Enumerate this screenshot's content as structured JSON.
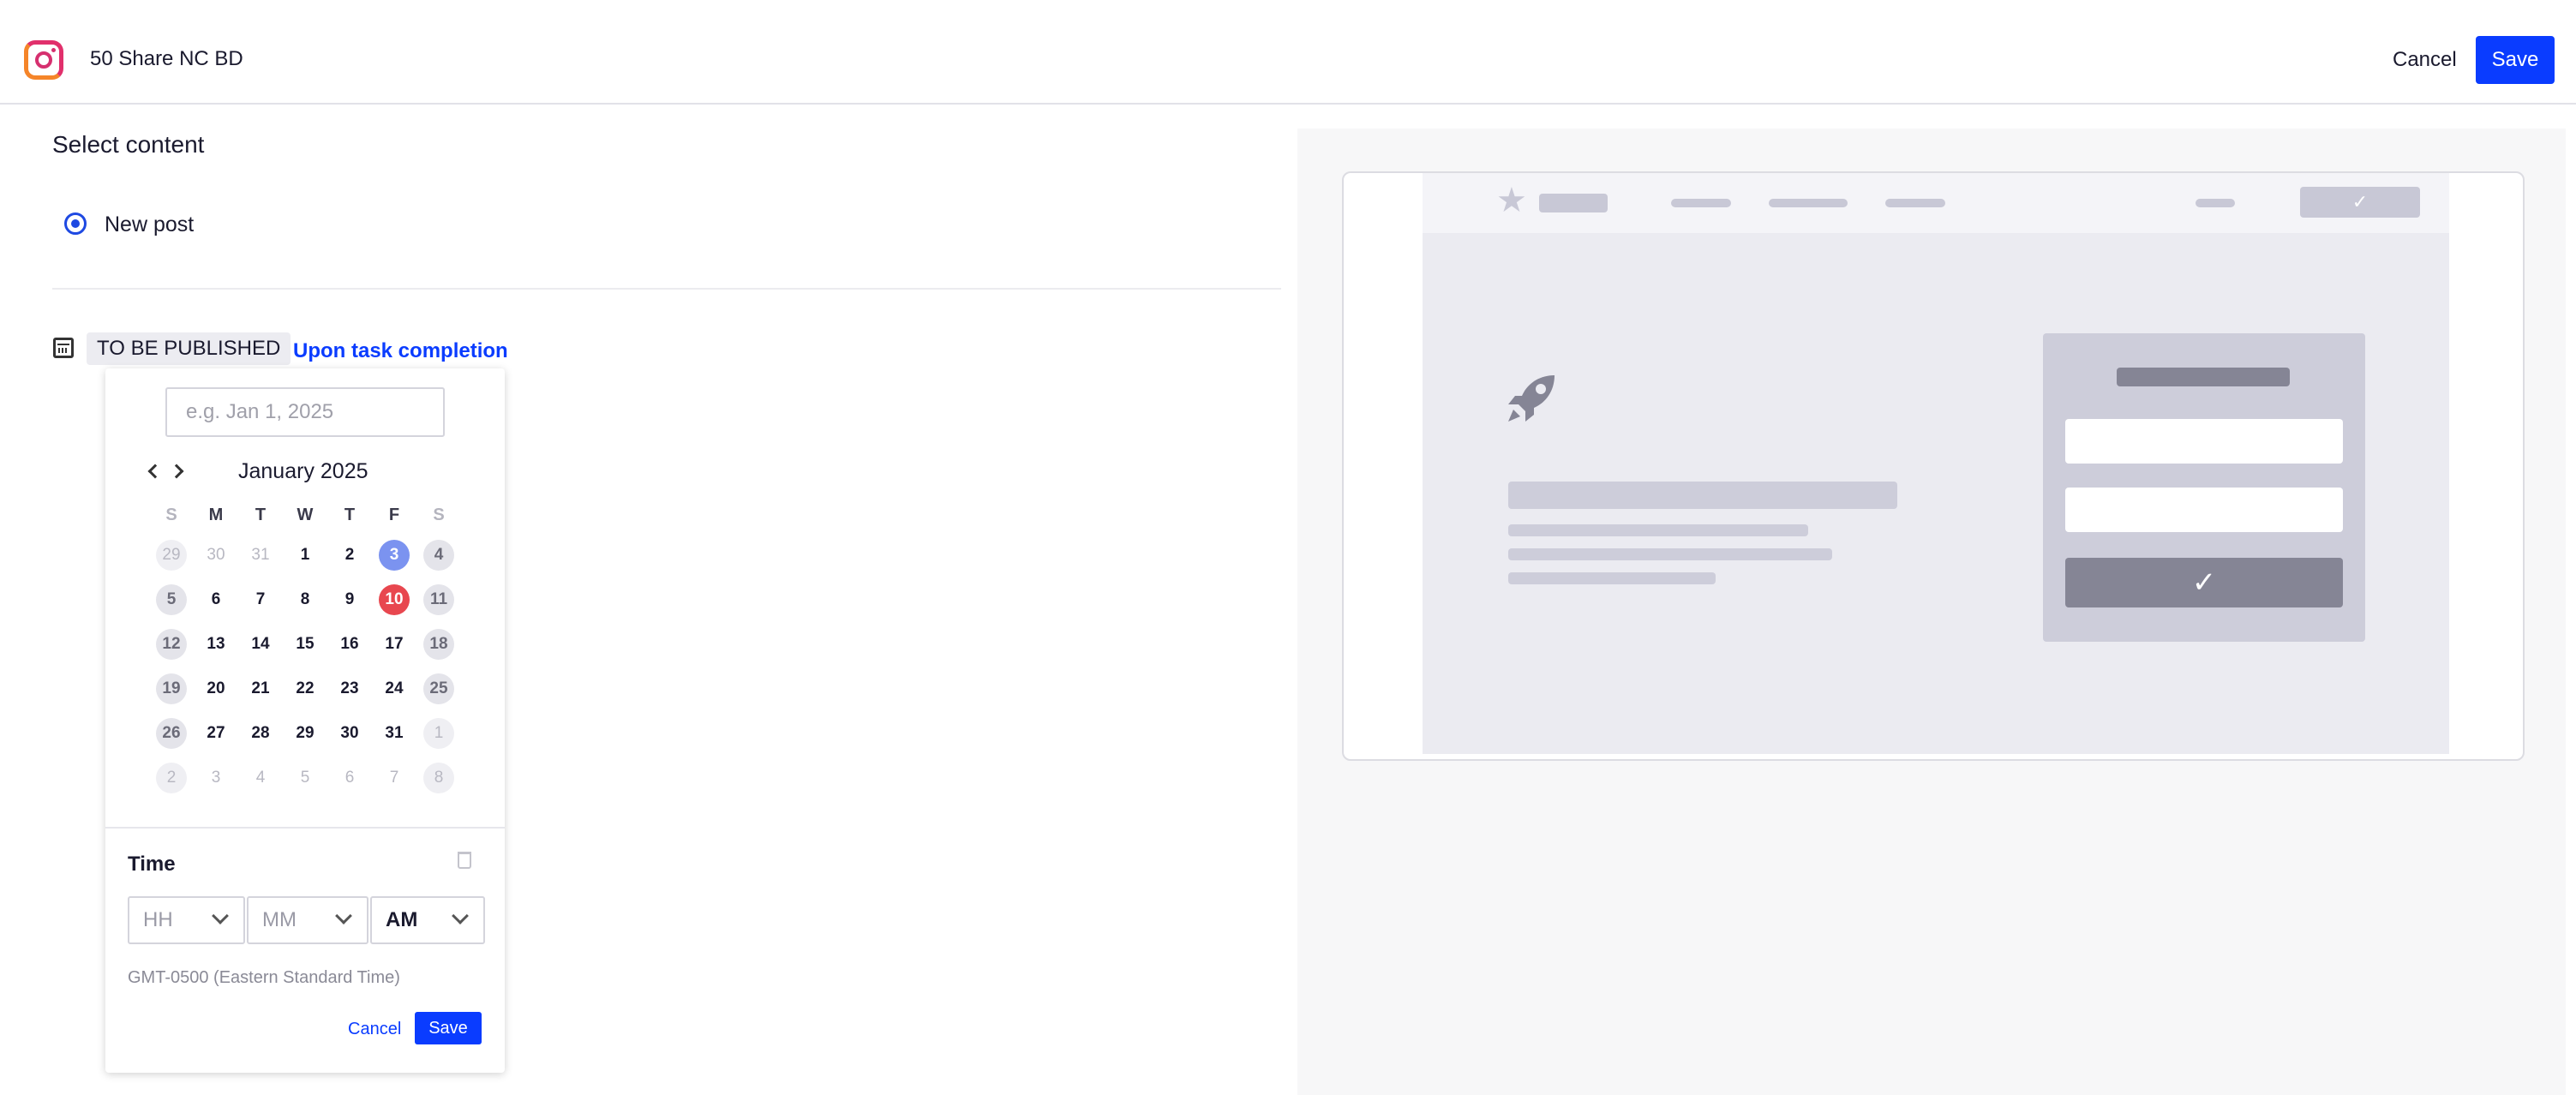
{
  "header": {
    "app_icon": "instagram-icon",
    "title": "50 Share NC BD",
    "cancel_label": "Cancel",
    "save_label": "Save",
    "accent_color": "#0a3cff"
  },
  "content": {
    "section_title": "Select content",
    "option_label": "New post"
  },
  "schedule": {
    "icon": "calendar-icon",
    "status_badge": "TO BE PUBLISHED",
    "trigger_link": "Upon task completion"
  },
  "datepicker": {
    "input_placeholder": "e.g. Jan 1, 2025",
    "month_label": "January 2025",
    "weekdays": [
      "S",
      "M",
      "T",
      "W",
      "T",
      "F",
      "S"
    ],
    "weeks": [
      [
        "29",
        "30",
        "31",
        "1",
        "2",
        "3",
        "4"
      ],
      [
        "5",
        "6",
        "7",
        "8",
        "9",
        "10",
        "11"
      ],
      [
        "12",
        "13",
        "14",
        "15",
        "16",
        "17",
        "18"
      ],
      [
        "19",
        "20",
        "21",
        "22",
        "23",
        "24",
        "25"
      ],
      [
        "26",
        "27",
        "28",
        "29",
        "30",
        "31",
        "1"
      ],
      [
        "2",
        "3",
        "4",
        "5",
        "6",
        "7",
        "8"
      ]
    ],
    "selected_day": "3",
    "today": "10",
    "selected_color": "#7b93f0",
    "today_color": "#e8474f",
    "time_label": "Time",
    "hour_placeholder": "HH",
    "minute_placeholder": "MM",
    "period_value": "AM",
    "timezone": "GMT-0500 (Eastern Standard Time)",
    "cancel_label": "Cancel",
    "save_label": "Save"
  },
  "preview": {
    "icons": [
      "star-icon",
      "rocket-icon",
      "check-icon"
    ]
  }
}
